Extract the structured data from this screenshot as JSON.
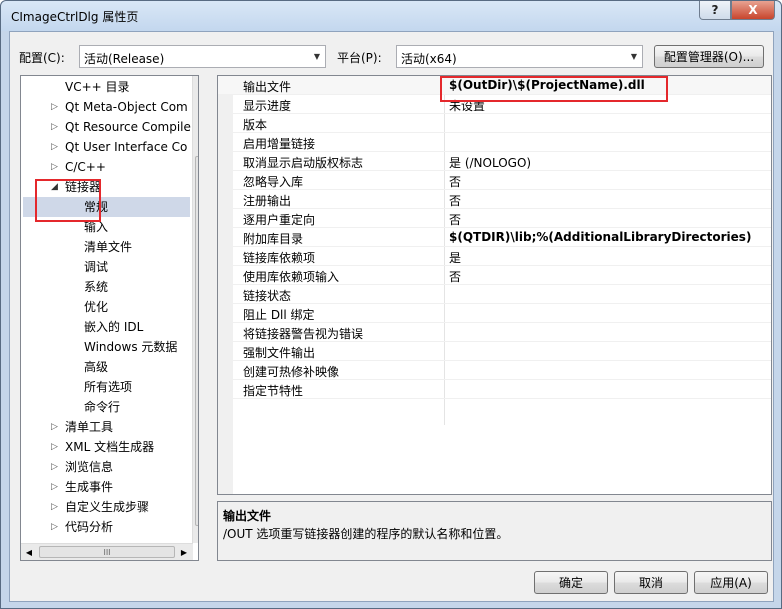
{
  "window": {
    "title": "CImageCtrlDlg 属性页",
    "help": "?",
    "close": "X"
  },
  "toolbar": {
    "config_label": "配置(C):",
    "config_value": "活动(Release)",
    "platform_label": "平台(P):",
    "platform_value": "活动(x64)",
    "config_manager": "配置管理器(O)..."
  },
  "tree": {
    "items": [
      {
        "label": "VC++ 目录",
        "indent": 1,
        "arrow": ""
      },
      {
        "label": "Qt Meta-Object Com",
        "indent": 1,
        "arrow": "right"
      },
      {
        "label": "Qt Resource Compile",
        "indent": 1,
        "arrow": "right"
      },
      {
        "label": "Qt User Interface Co",
        "indent": 1,
        "arrow": "right"
      },
      {
        "label": "C/C++",
        "indent": 1,
        "arrow": "right"
      },
      {
        "label": "链接器",
        "indent": 1,
        "arrow": "down"
      },
      {
        "label": "常规",
        "indent": 2,
        "arrow": "",
        "selected": true
      },
      {
        "label": "输入",
        "indent": 2,
        "arrow": ""
      },
      {
        "label": "清单文件",
        "indent": 2,
        "arrow": ""
      },
      {
        "label": "调试",
        "indent": 2,
        "arrow": ""
      },
      {
        "label": "系统",
        "indent": 2,
        "arrow": ""
      },
      {
        "label": "优化",
        "indent": 2,
        "arrow": ""
      },
      {
        "label": "嵌入的 IDL",
        "indent": 2,
        "arrow": ""
      },
      {
        "label": "Windows 元数据",
        "indent": 2,
        "arrow": ""
      },
      {
        "label": "高级",
        "indent": 2,
        "arrow": ""
      },
      {
        "label": "所有选项",
        "indent": 2,
        "arrow": ""
      },
      {
        "label": "命令行",
        "indent": 2,
        "arrow": ""
      },
      {
        "label": "清单工具",
        "indent": 1,
        "arrow": "right"
      },
      {
        "label": "XML 文档生成器",
        "indent": 1,
        "arrow": "right"
      },
      {
        "label": "浏览信息",
        "indent": 1,
        "arrow": "right"
      },
      {
        "label": "生成事件",
        "indent": 1,
        "arrow": "right"
      },
      {
        "label": "自定义生成步骤",
        "indent": 1,
        "arrow": "right"
      },
      {
        "label": "代码分析",
        "indent": 1,
        "arrow": "right"
      }
    ],
    "hscroll_grip": "III"
  },
  "properties": [
    {
      "name": "输出文件",
      "value": "$(OutDir)\\$(ProjectName).dll",
      "bold": true
    },
    {
      "name": "显示进度",
      "value": "未设置",
      "bold": false
    },
    {
      "name": "版本",
      "value": "",
      "bold": false
    },
    {
      "name": "启用增量链接",
      "value": "",
      "bold": false
    },
    {
      "name": "取消显示启动版权标志",
      "value": "是 (/NOLOGO)",
      "bold": false
    },
    {
      "name": "忽略导入库",
      "value": "否",
      "bold": false
    },
    {
      "name": "注册输出",
      "value": "否",
      "bold": false
    },
    {
      "name": "逐用户重定向",
      "value": "否",
      "bold": false
    },
    {
      "name": "附加库目录",
      "value": "$(QTDIR)\\lib;%(AdditionalLibraryDirectories)",
      "bold": true
    },
    {
      "name": "链接库依赖项",
      "value": "是",
      "bold": false
    },
    {
      "name": "使用库依赖项输入",
      "value": "否",
      "bold": false
    },
    {
      "name": "链接状态",
      "value": "",
      "bold": false
    },
    {
      "name": "阻止 Dll 绑定",
      "value": "",
      "bold": false
    },
    {
      "name": "将链接器警告视为错误",
      "value": "",
      "bold": false
    },
    {
      "name": "强制文件输出",
      "value": "",
      "bold": false
    },
    {
      "name": "创建可热修补映像",
      "value": "",
      "bold": false
    },
    {
      "name": "指定节特性",
      "value": "",
      "bold": false
    }
  ],
  "description": {
    "title": "输出文件",
    "text": "/OUT 选项重写链接器创建的程序的默认名称和位置。"
  },
  "buttons": {
    "ok": "确定",
    "cancel": "取消",
    "apply": "应用(A)"
  },
  "colors": {
    "highlight_red": "#e4282c",
    "selected_bg": "#cfd8e8"
  }
}
